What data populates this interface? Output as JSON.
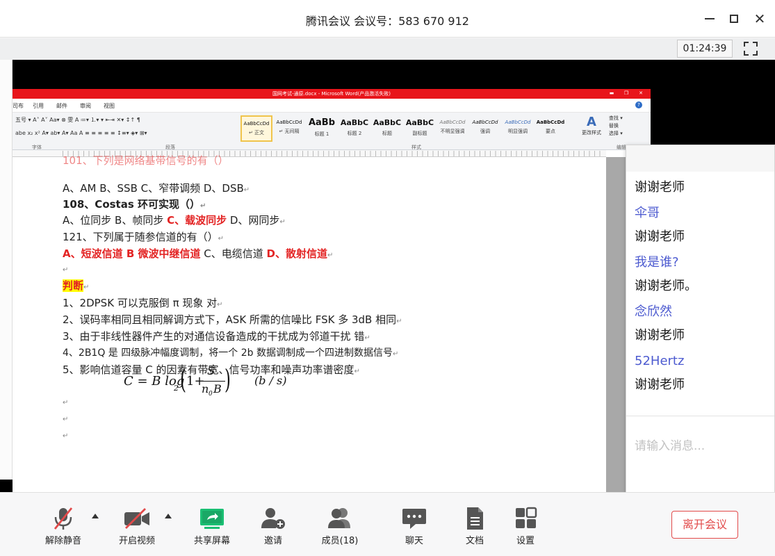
{
  "window": {
    "title": "腾讯会议 会议号：583 670 912",
    "timer": "01:24:39"
  },
  "word": {
    "title": "国网考试-通原.docx - Microsoft Word(产品激活失败)",
    "menu": [
      "司布",
      "引用",
      "邮件",
      "审阅",
      "视图"
    ],
    "ribbon_row1": "五号 ▾  A˄ A˅  Aa▾  ⊗ 雯 A   ≔▾ ⒈▾ ▾  ⇤⇥  ✕▾  ↕↑  ¶",
    "ribbon_row2": "abe  x₂  x²  A▾ ab▾ A▾ Aa A   ≡ ≡ ≡ ≡ ≡  ↕≡▾  ◈▾  ⊞▾",
    "group_labels": [
      "字体",
      "段落",
      "样式",
      "编辑"
    ],
    "styles": [
      {
        "preview": "AaBbCcDd",
        "name": "↵ 正文"
      },
      {
        "preview": "AaBbCcDd",
        "name": "↵ 无间隔"
      },
      {
        "preview": "AaBb",
        "name": "标题 1"
      },
      {
        "preview": "AaBbC",
        "name": "标题 2"
      },
      {
        "preview": "AaBbC",
        "name": "标题"
      },
      {
        "preview": "AaBbC",
        "name": "副标题"
      },
      {
        "preview": "AaBbCcDd",
        "name": "不明显强调"
      },
      {
        "preview": "AaBbCcDd",
        "name": "强调"
      },
      {
        "preview": "AaBbCcDd",
        "name": "明显强调"
      },
      {
        "preview": "AaBbCcDd",
        "name": "要点"
      }
    ],
    "change_styles": "更改样式",
    "edit_tools": [
      "查找 ▾",
      "替换",
      "选择 ▾"
    ]
  },
  "document": {
    "line_partial": "101、下列是网络基带信号的有（）",
    "q101_options": "A、AM    B、SSB    C、窄带调频    D、DSB",
    "q108_title": "108、Costas 环可实现（）",
    "q108_a": "A、位同步 B、帧同步 ",
    "q108_c": "C、载波同步",
    "q108_d": " D、网同步",
    "q121_title": "121、下列属于随参信道的有（）",
    "q121_a": "A、短波信道   B 微波中继信道",
    "q121_c": "   C、电缆信道   ",
    "q121_d": "D、散射信道",
    "section_title": "判断",
    "j1": "1、2DPSK 可以克服倒 π 现象                  对",
    "j2": "2、误码率相同且相同解调方式下，ASK 所需的信噪比 FSK 多 3dB                  相同",
    "j3": "3、由于非线性器件产生的对通信设备造成的干扰成为邻道干扰                      错",
    "j4": "4、2B1Q 是               四级脉冲幅度调制，将一个 2b 数据调制成一个四进制数据信号",
    "j5": "5、影响信道容量 C 的因素有带宽、信号功率和噪声功率谱密度",
    "formula_lhs": "C = B log",
    "formula_sub": "2",
    "formula_one": "1+",
    "formula_num": "S",
    "formula_den": "n",
    "formula_den_sub": "0",
    "formula_den_b": "B",
    "formula_unit": "(b / s)",
    "para_mark": "↵"
  },
  "chat": {
    "messages": [
      {
        "name": "",
        "text": "谢谢老师"
      },
      {
        "name": "伞哥",
        "text": "谢谢老师"
      },
      {
        "name": "我是谁?",
        "text": "谢谢老师。"
      },
      {
        "name": "念欣然",
        "text": "谢谢老师"
      },
      {
        "name": "52Hertz",
        "text": "谢谢老师"
      }
    ],
    "input_placeholder": "请输入消息..."
  },
  "toolbar": {
    "unmute": "解除静音",
    "start_video": "开启视频",
    "share_screen": "共享屏幕",
    "invite": "邀请",
    "members": "成员(18)",
    "chat": "聊天",
    "docs": "文档",
    "settings": "设置",
    "leave": "离开会议"
  },
  "colors": {
    "accent_green": "#1bbf73",
    "leave_red": "#e24a4a",
    "chat_name": "#4d5bd0",
    "word_red": "#e8151b"
  }
}
